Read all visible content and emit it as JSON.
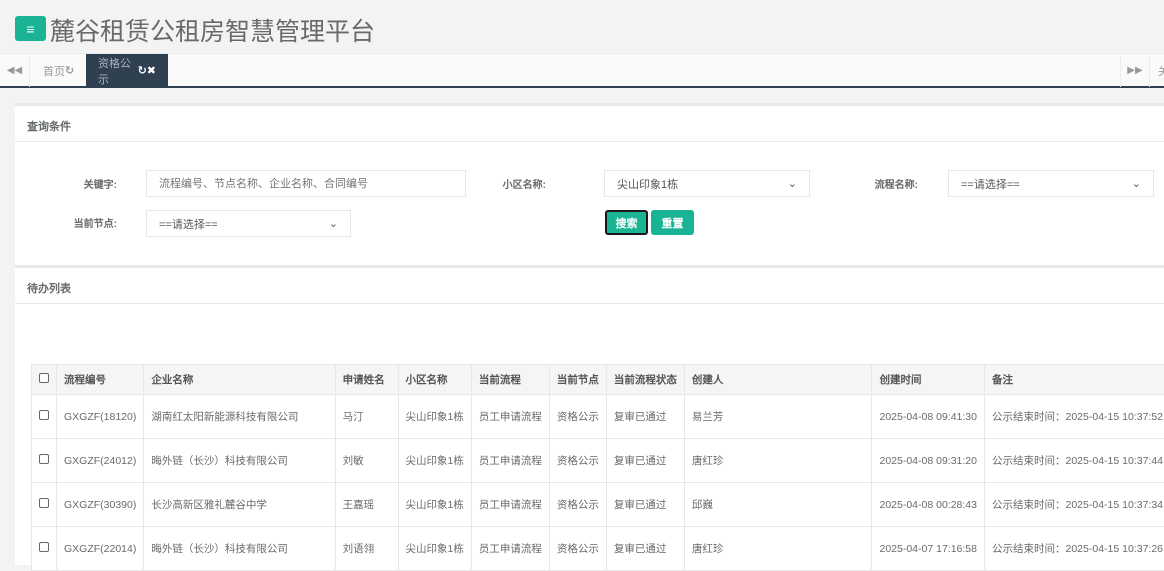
{
  "header": {
    "title": "麓谷租赁公租房智慧管理平台",
    "menu_icon": "bars-icon"
  },
  "tabs": [
    {
      "label": "首页"
    },
    {
      "label": "资格公示"
    }
  ],
  "tabbar": {
    "right_label": "关"
  },
  "search_panel": {
    "title": "查询条件",
    "keyword_label": "关键字:",
    "keyword_placeholder": "流程编号、节点名称、企业名称、合同编号",
    "keyword_value": "",
    "community_label": "小区名称:",
    "community_value": "尖山印象1栋",
    "process_label": "流程名称:",
    "process_value": "==请选择==",
    "node_label": "当前节点:",
    "node_value": "==请选择==",
    "search_button": "搜索",
    "reset_button": "重置"
  },
  "list_panel": {
    "title": "待办列表",
    "columns": [
      "流程编号",
      "企业名称",
      "申请姓名",
      "小区名称",
      "当前流程",
      "当前节点",
      "当前流程状态",
      "创建人",
      "创建时间",
      "备注"
    ],
    "rows": [
      [
        "GXGZF(18120)",
        "湖南红太阳新能源科技有限公司",
        "马汀",
        "尖山印象1栋",
        "员工申请流程",
        "资格公示",
        "复审已通过",
        "易兰芳",
        "2025-04-08 09:41:30",
        "公示结束时间：2025-04-15 10:37:52"
      ],
      [
        "GXGZF(24012)",
        "晦外链（长沙）科技有限公司",
        "刘敏",
        "尖山印象1栋",
        "员工申请流程",
        "资格公示",
        "复审已通过",
        "唐红珍",
        "2025-04-08 09:31:20",
        "公示结束时间：2025-04-15 10:37:44"
      ],
      [
        "GXGZF(30390)",
        "长沙高新区雅礼麓谷中学",
        "王嘉瑶",
        "尖山印象1栋",
        "员工申请流程",
        "资格公示",
        "复审已通过",
        "邱巍",
        "2025-04-08 00:28:43",
        "公示结束时间：2025-04-15 10:37:34"
      ],
      [
        "GXGZF(22014)",
        "晦外链（长沙）科技有限公司",
        "刘语翎",
        "尖山印象1栋",
        "员工申请流程",
        "资格公示",
        "复审已通过",
        "唐红珍",
        "2025-04-07 17:16:58",
        "公示结束时间：2025-04-15 10:37:26"
      ]
    ]
  },
  "colors": {
    "accent": "#1ab394",
    "dark": "#2f4050"
  }
}
